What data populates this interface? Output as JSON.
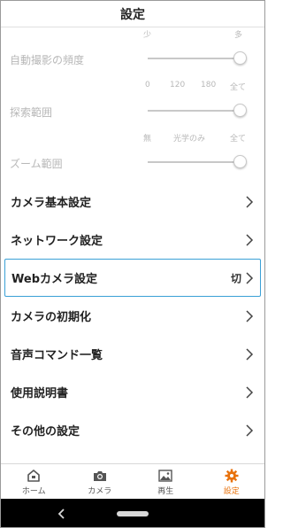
{
  "header": {
    "title": "設定"
  },
  "sliders": [
    {
      "label": "自動撮影の頻度",
      "ticks": [
        "少",
        "多"
      ],
      "value_fraction": 1.0
    },
    {
      "label": "探索範囲",
      "ticks": [
        "0",
        "120",
        "180",
        "全て"
      ],
      "value_fraction": 1.0
    },
    {
      "label": "ズーム範囲",
      "ticks": [
        "無",
        "光学のみ",
        "全て"
      ],
      "value_fraction": 1.0
    }
  ],
  "menu": [
    {
      "label": "カメラ基本設定"
    },
    {
      "label": "ネットワーク設定"
    },
    {
      "label": "Webカメラ設定",
      "value": "切"
    },
    {
      "label": "カメラの初期化"
    },
    {
      "label": "音声コマンド一覧"
    },
    {
      "label": "使用説明書"
    },
    {
      "label": "その他の設定"
    }
  ],
  "tabs": [
    {
      "label": "ホーム",
      "icon": "home-icon"
    },
    {
      "label": "カメラ",
      "icon": "camera-icon"
    },
    {
      "label": "再生",
      "icon": "picture-icon"
    },
    {
      "label": "設定",
      "icon": "gear-icon"
    }
  ],
  "colors": {
    "accent": "#e8720c",
    "highlight_border": "#3aa0d6",
    "disabled_text": "#b8b8b8"
  }
}
